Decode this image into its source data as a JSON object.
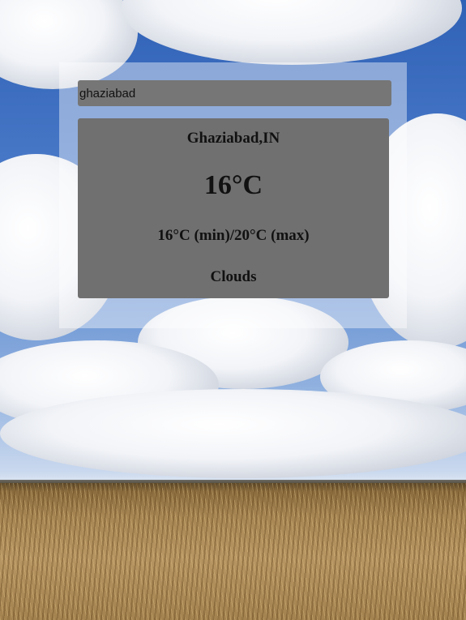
{
  "search": {
    "value": "ghaziabad"
  },
  "weather": {
    "city": "Ghaziabad,IN",
    "temperature": "16°C",
    "min_max": "16°C (min)/20°C (max)",
    "condition": "Clouds"
  },
  "colors": {
    "panel_overlay": "#ffffff",
    "card_background": "#707070",
    "input_background": "#767676",
    "text": "#111111"
  }
}
